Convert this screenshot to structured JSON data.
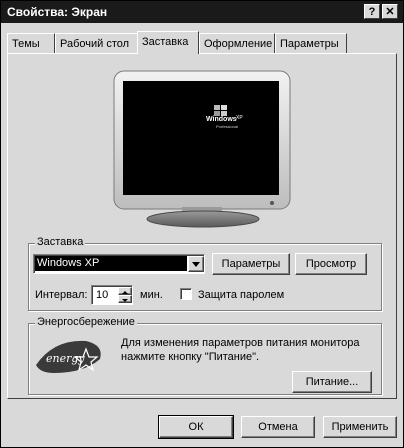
{
  "window": {
    "title": "Свойства: Экран",
    "help_glyph": "?",
    "close_glyph": "✕"
  },
  "tabs": [
    {
      "label": "Темы",
      "active": false
    },
    {
      "label": "Рабочий стол",
      "active": false
    },
    {
      "label": "Заставка",
      "active": true
    },
    {
      "label": "Оформление",
      "active": false
    },
    {
      "label": "Параметры",
      "active": false
    }
  ],
  "preview": {
    "logo_text": "Windows",
    "logo_sup": "XP",
    "logo_edition": "Professional"
  },
  "screensaver": {
    "group_label": "Заставка",
    "selected": "Windows XP",
    "params_button": "Параметры",
    "preview_button": "Просмотр",
    "interval_label": "Интервал:",
    "interval_value": "10",
    "interval_unit": "мин.",
    "password_label": "Защита паролем",
    "password_checked": false
  },
  "energy": {
    "group_label": "Энергосбережение",
    "logo_text": "energy",
    "description_line1": "Для изменения параметров питания монитора",
    "description_line2": "нажмите кнопку \"Питание\".",
    "power_button": "Питание..."
  },
  "footer": {
    "ok": "ОК",
    "cancel": "Отмена",
    "apply": "Применить"
  }
}
